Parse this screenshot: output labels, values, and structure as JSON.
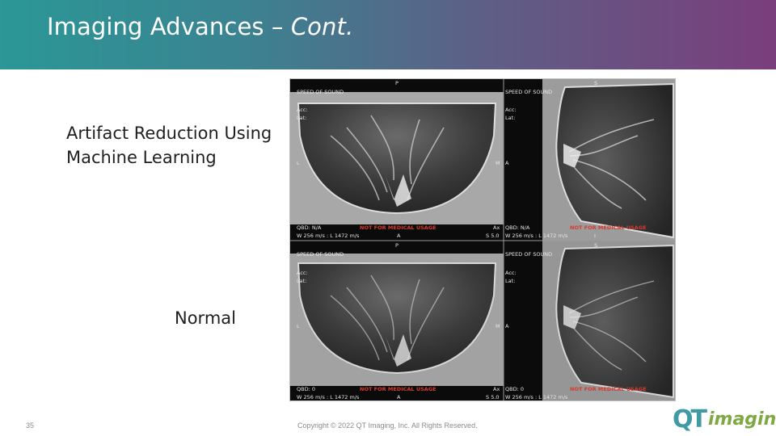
{
  "slide": {
    "title_main": "Imaging Advances – ",
    "title_italic": "Cont.",
    "label_ml": "Artifact Reduction Using Machine Learning",
    "label_normal": "Normal",
    "page_number": "35",
    "copyright": "Copyright © 2022 QT Imaging, Inc. All Rights Reserved.",
    "logo_q": "QT",
    "logo_word": "imaging"
  },
  "colors": {
    "header_start": "#2b9796",
    "header_end": "#7a3e7c",
    "warning_red": "#d53a2f",
    "logo_teal": "#3f9aa3",
    "logo_green": "#7ea842"
  },
  "viewer": {
    "panels": [
      {
        "id": "ml-coronal",
        "orient_top": "P",
        "mode": "SPEED OF SOUND",
        "acc": "Acc:",
        "lat": "Lat:",
        "left_marker": "L",
        "right_marker": "M",
        "qbd": "QBD: N/A",
        "warning": "NOT FOR MEDICAL USAGE",
        "window": "W 256 m/s : L 1472 m/s",
        "orient_bottom": "A",
        "view": "Ax",
        "slice": "S 5.0"
      },
      {
        "id": "ml-sagittal",
        "orient_top": "S",
        "mode": "SPEED OF SOUND",
        "acc": "Acc:",
        "lat": "Lat:",
        "left_marker": "A",
        "qbd": "QBD: N/A",
        "warning": "NOT FOR MEDICAL USAGE",
        "window": "W 256 m/s : L 1472 m/s",
        "orient_bottom": "I"
      },
      {
        "id": "normal-coronal",
        "orient_top": "P",
        "mode": "SPEED OF SOUND",
        "acc": "Acc:",
        "lat": "Lat:",
        "left_marker": "L",
        "right_marker": "M",
        "qbd": "QBD: 0",
        "warning": "NOT FOR MEDICAL USAGE",
        "window": "W 256 m/s : L 1472 m/s",
        "orient_bottom": "A",
        "view": "Ax",
        "slice": "S 5.0"
      },
      {
        "id": "normal-sagittal",
        "orient_top": "S",
        "mode": "SPEED OF SOUND",
        "acc": "Acc:",
        "lat": "Lat:",
        "left_marker": "A",
        "qbd": "QBD: 0",
        "warning": "NOT FOR MEDICAL USAGE",
        "window": "W 256 m/s : L 1472 m/s"
      }
    ]
  }
}
